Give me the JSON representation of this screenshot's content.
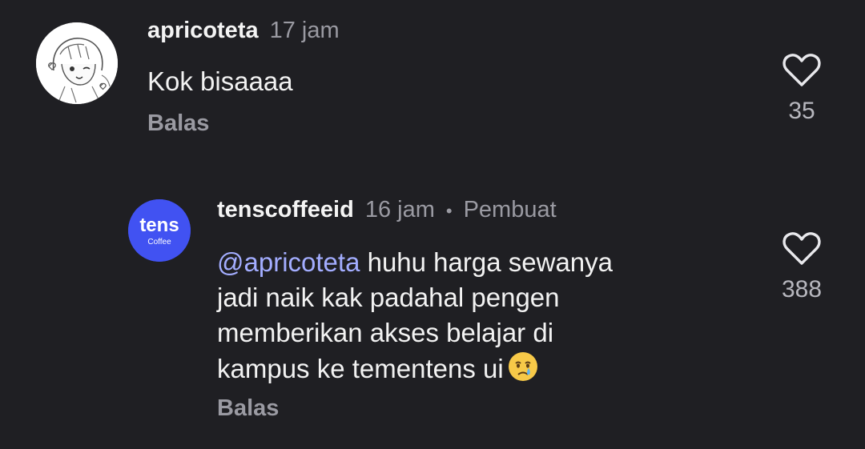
{
  "comments": [
    {
      "username": "apricoteta",
      "time": "17 jam",
      "text": "Kok bisaaaa",
      "reply_label": "Balas",
      "likes": "35",
      "avatar_icon": "anime-sketch-avatar"
    },
    {
      "username": "tenscoffeeid",
      "time": "16 jam",
      "separator": "•",
      "badge": "Pembuat",
      "mention": "@apricoteta",
      "text_line1": " huhu harga sewanya",
      "text_line2": "jadi naik kak padahal pengen",
      "text_line3": "memberikan akses belajar di",
      "text_line4": "kampus ke tementens ui",
      "emoji_name": "crying-face-icon",
      "reply_label": "Balas",
      "likes": "388",
      "avatar_logo_main": "tens",
      "avatar_logo_sub": "Coffee",
      "avatar_color": "#4152f2"
    }
  ],
  "colors": {
    "background": "#1f1f23",
    "mention": "#a3adff",
    "muted": "#9a9aa2"
  }
}
